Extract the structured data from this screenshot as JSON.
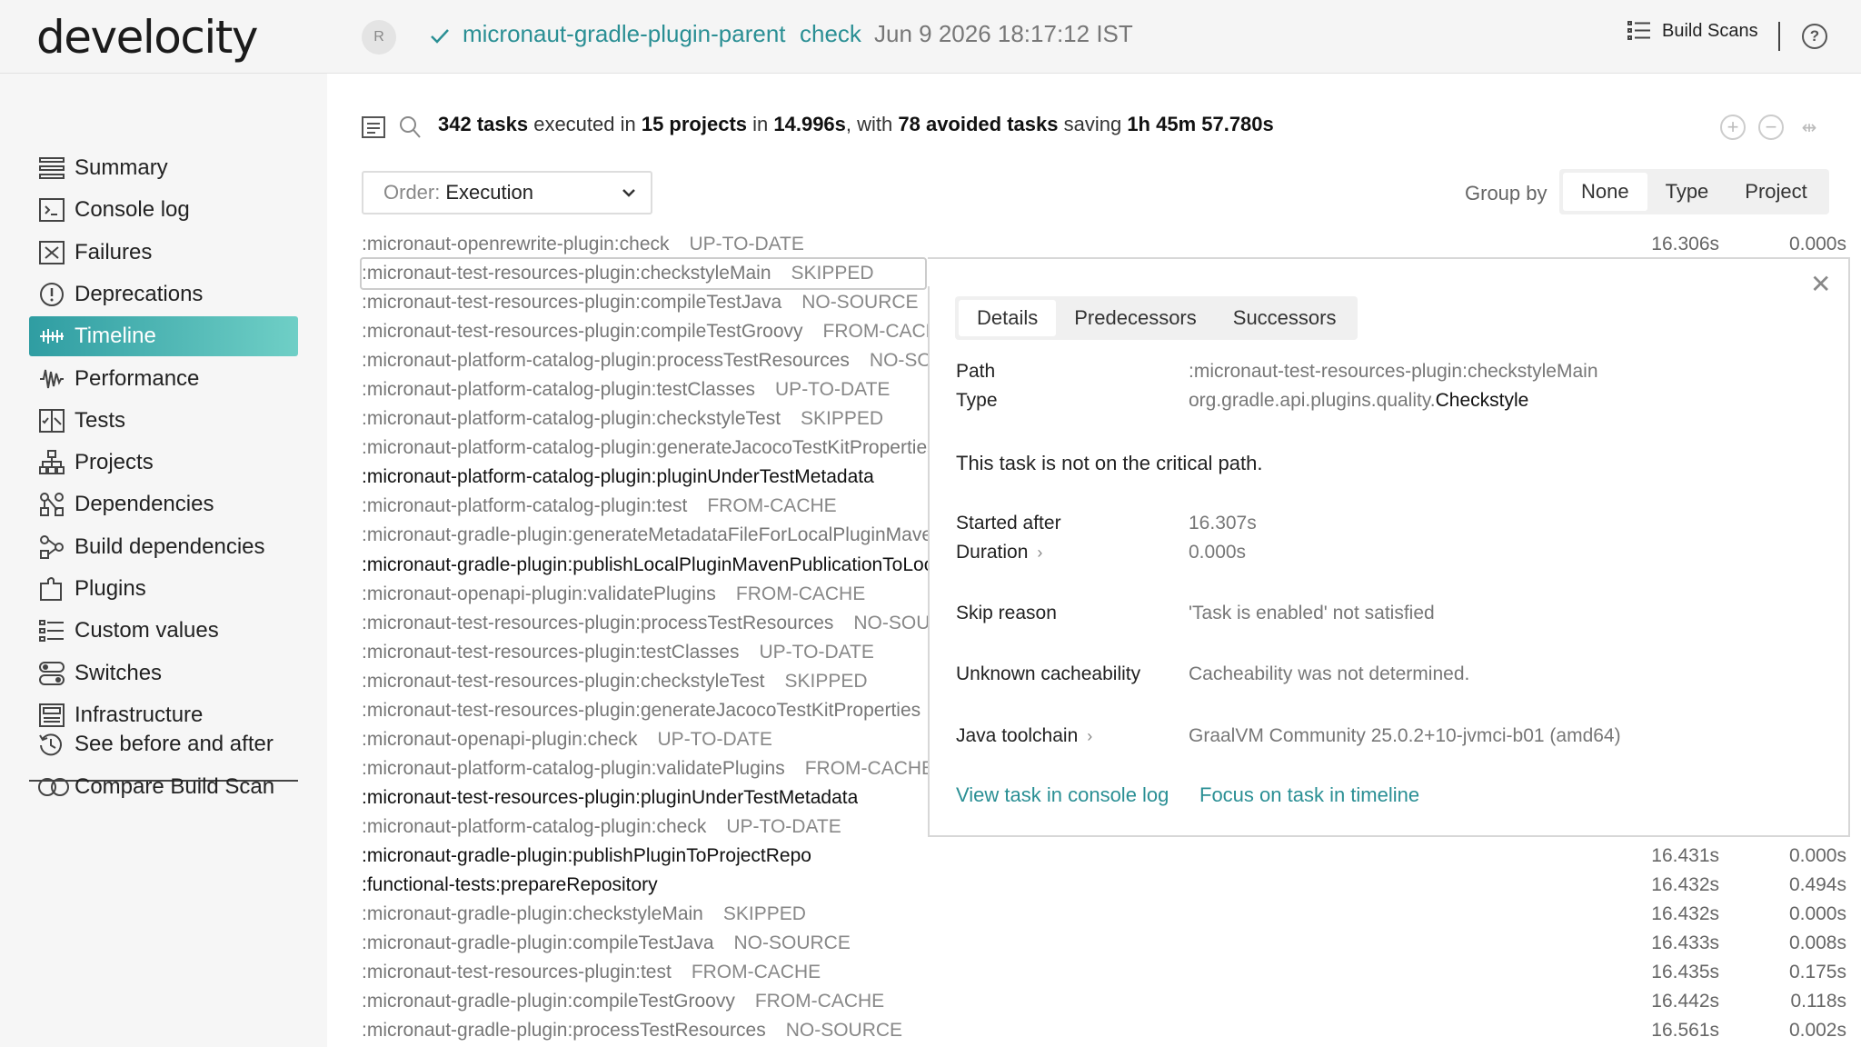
{
  "header": {
    "logo": "develocity",
    "avatar_initial": "R",
    "project": "micronaut-gradle-plugin-parent",
    "task": "check",
    "date": "Jun 9 2026 18:17:12 IST",
    "build_scans_label": "Build Scans",
    "help": "?"
  },
  "sidebar": {
    "items": [
      {
        "label": "Summary",
        "icon": "summary-icon"
      },
      {
        "label": "Console log",
        "icon": "console-icon"
      },
      {
        "label": "Failures",
        "icon": "failures-icon"
      },
      {
        "label": "Deprecations",
        "icon": "deprecations-icon"
      },
      {
        "label": "Timeline",
        "icon": "timeline-icon",
        "active": true
      },
      {
        "label": "Performance",
        "icon": "performance-icon"
      },
      {
        "label": "Tests",
        "icon": "tests-icon"
      },
      {
        "label": "Projects",
        "icon": "projects-icon"
      },
      {
        "label": "Dependencies",
        "icon": "dependencies-icon"
      },
      {
        "label": "Build dependencies",
        "icon": "build-dependencies-icon"
      },
      {
        "label": "Plugins",
        "icon": "plugins-icon"
      },
      {
        "label": "Custom values",
        "icon": "custom-values-icon"
      },
      {
        "label": "Switches",
        "icon": "switches-icon"
      },
      {
        "label": "Infrastructure",
        "icon": "infrastructure-icon"
      }
    ],
    "bottom_items": [
      {
        "label": "See before and after",
        "icon": "history-icon"
      },
      {
        "label": "Compare Build Scan",
        "icon": "compare-icon"
      }
    ]
  },
  "summary": {
    "tasks": "342 tasks",
    "t1": " executed in ",
    "projects": "15 projects",
    "t2": " in ",
    "time": "14.996s",
    "t3": ", with ",
    "avoided": "78 avoided tasks",
    "t4": " saving ",
    "saving": "1h 45m 57.780s"
  },
  "controls": {
    "order_label": "Order:",
    "order_value": "Execution",
    "group_by_label": "Group by",
    "group_options": [
      "None",
      "Type",
      "Project"
    ],
    "group_selected": "None"
  },
  "tasks": [
    {
      "name": ":micronaut-openrewrite-plugin:check",
      "outcome": "UP-TO-DATE",
      "start": "16.306s",
      "duration": "0.000s"
    },
    {
      "name": ":micronaut-test-resources-plugin:checkstyleMain",
      "outcome": "SKIPPED",
      "selected": true
    },
    {
      "name": ":micronaut-test-resources-plugin:compileTestJava",
      "outcome": "NO-SOURCE"
    },
    {
      "name": ":micronaut-test-resources-plugin:compileTestGroovy",
      "outcome": "FROM-CACHE"
    },
    {
      "name": ":micronaut-platform-catalog-plugin:processTestResources",
      "outcome": "NO-SOURCE"
    },
    {
      "name": ":micronaut-platform-catalog-plugin:testClasses",
      "outcome": "UP-TO-DATE"
    },
    {
      "name": ":micronaut-platform-catalog-plugin:checkstyleTest",
      "outcome": "SKIPPED"
    },
    {
      "name": ":micronaut-platform-catalog-plugin:generateJacocoTestKitProperties",
      "outcome": ""
    },
    {
      "name": ":micronaut-platform-catalog-plugin:pluginUnderTestMetadata",
      "outcome": "",
      "dark": true
    },
    {
      "name": ":micronaut-platform-catalog-plugin:test",
      "outcome": "FROM-CACHE"
    },
    {
      "name": ":micronaut-gradle-plugin:generateMetadataFileForLocalPluginMavenPublication",
      "outcome": ""
    },
    {
      "name": ":micronaut-gradle-plugin:publishLocalPluginMavenPublicationToLocal",
      "outcome": "",
      "dark": true
    },
    {
      "name": ":micronaut-openapi-plugin:validatePlugins",
      "outcome": "FROM-CACHE"
    },
    {
      "name": ":micronaut-test-resources-plugin:processTestResources",
      "outcome": "NO-SOURCE"
    },
    {
      "name": ":micronaut-test-resources-plugin:testClasses",
      "outcome": "UP-TO-DATE"
    },
    {
      "name": ":micronaut-test-resources-plugin:checkstyleTest",
      "outcome": "SKIPPED"
    },
    {
      "name": ":micronaut-test-resources-plugin:generateJacocoTestKitProperties",
      "outcome": ""
    },
    {
      "name": ":micronaut-openapi-plugin:check",
      "outcome": "UP-TO-DATE"
    },
    {
      "name": ":micronaut-platform-catalog-plugin:validatePlugins",
      "outcome": "FROM-CACHE"
    },
    {
      "name": ":micronaut-test-resources-plugin:pluginUnderTestMetadata",
      "outcome": "",
      "dark": true
    },
    {
      "name": ":micronaut-platform-catalog-plugin:check",
      "outcome": "UP-TO-DATE"
    },
    {
      "name": ":micronaut-gradle-plugin:publishPluginToProjectRepo",
      "outcome": "",
      "dark": true,
      "start": "16.431s",
      "duration": "0.000s"
    },
    {
      "name": ":functional-tests:prepareRepository",
      "outcome": "",
      "dark": true,
      "start": "16.432s",
      "duration": "0.494s"
    },
    {
      "name": ":micronaut-gradle-plugin:checkstyleMain",
      "outcome": "SKIPPED",
      "start": "16.432s",
      "duration": "0.000s"
    },
    {
      "name": ":micronaut-gradle-plugin:compileTestJava",
      "outcome": "NO-SOURCE",
      "start": "16.433s",
      "duration": "0.008s"
    },
    {
      "name": ":micronaut-test-resources-plugin:test",
      "outcome": "FROM-CACHE",
      "start": "16.435s",
      "duration": "0.175s"
    },
    {
      "name": ":micronaut-gradle-plugin:compileTestGroovy",
      "outcome": "FROM-CACHE",
      "start": "16.442s",
      "duration": "0.118s"
    },
    {
      "name": ":micronaut-gradle-plugin:processTestResources",
      "outcome": "NO-SOURCE",
      "start": "16.561s",
      "duration": "0.002s"
    }
  ],
  "details": {
    "tabs": [
      "Details",
      "Predecessors",
      "Successors"
    ],
    "selected_tab": "Details",
    "path_label": "Path",
    "path_value": ":micronaut-test-resources-plugin:checkstyleMain",
    "type_label": "Type",
    "type_prefix": "org.gradle.api.plugins.quality.",
    "type_class": "Checkstyle",
    "critical_note": "This task is not on the critical path.",
    "started_label": "Started after",
    "started_value": "16.307s",
    "duration_label": "Duration",
    "duration_value": "0.000s",
    "skip_label": "Skip reason",
    "skip_value": "'Task is enabled' not satisfied",
    "cache_label": "Unknown cacheability",
    "cache_value": "Cacheability was not determined.",
    "toolchain_label": "Java toolchain",
    "toolchain_value": "GraalVM Community 25.0.2+10-jvmci-b01 (amd64)",
    "link_console": "View task in console log",
    "link_timeline": "Focus on task in timeline"
  },
  "colors": {
    "accent": "#2a8f94",
    "active_nav_start": "#2f9da2",
    "active_nav_end": "#6fcfc6"
  }
}
